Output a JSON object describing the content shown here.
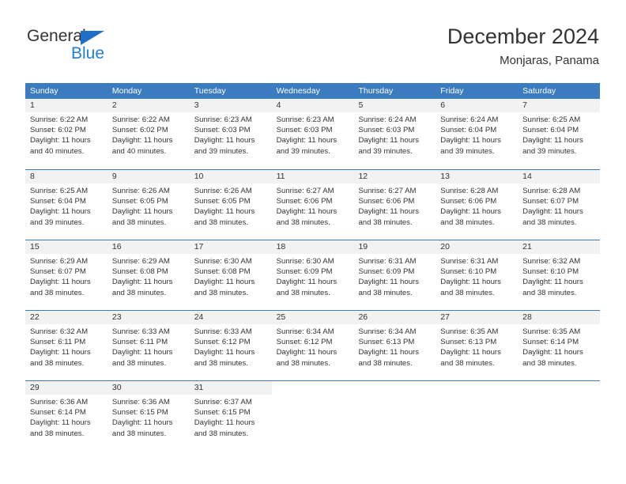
{
  "logo": {
    "word_one": "General",
    "word_two": "Blue",
    "triangle_icon": "blue-triangle-icon",
    "accent_color": "#1f7fd4"
  },
  "header": {
    "title": "December 2024",
    "subtitle": "Monjaras, Panama"
  },
  "theme": {
    "header_row_bg": "#3b7cc0",
    "day_number_band_bg": "#f2f2f2",
    "grid_line": "#3b7cc0",
    "text": "#333333"
  },
  "calendar": {
    "day_names": [
      "Sunday",
      "Monday",
      "Tuesday",
      "Wednesday",
      "Thursday",
      "Friday",
      "Saturday"
    ],
    "weeks": [
      [
        {
          "day": "1",
          "sunrise": "Sunrise: 6:22 AM",
          "sunset": "Sunset: 6:02 PM",
          "daylight_1": "Daylight: 11 hours",
          "daylight_2": "and 40 minutes."
        },
        {
          "day": "2",
          "sunrise": "Sunrise: 6:22 AM",
          "sunset": "Sunset: 6:02 PM",
          "daylight_1": "Daylight: 11 hours",
          "daylight_2": "and 40 minutes."
        },
        {
          "day": "3",
          "sunrise": "Sunrise: 6:23 AM",
          "sunset": "Sunset: 6:03 PM",
          "daylight_1": "Daylight: 11 hours",
          "daylight_2": "and 39 minutes."
        },
        {
          "day": "4",
          "sunrise": "Sunrise: 6:23 AM",
          "sunset": "Sunset: 6:03 PM",
          "daylight_1": "Daylight: 11 hours",
          "daylight_2": "and 39 minutes."
        },
        {
          "day": "5",
          "sunrise": "Sunrise: 6:24 AM",
          "sunset": "Sunset: 6:03 PM",
          "daylight_1": "Daylight: 11 hours",
          "daylight_2": "and 39 minutes."
        },
        {
          "day": "6",
          "sunrise": "Sunrise: 6:24 AM",
          "sunset": "Sunset: 6:04 PM",
          "daylight_1": "Daylight: 11 hours",
          "daylight_2": "and 39 minutes."
        },
        {
          "day": "7",
          "sunrise": "Sunrise: 6:25 AM",
          "sunset": "Sunset: 6:04 PM",
          "daylight_1": "Daylight: 11 hours",
          "daylight_2": "and 39 minutes."
        }
      ],
      [
        {
          "day": "8",
          "sunrise": "Sunrise: 6:25 AM",
          "sunset": "Sunset: 6:04 PM",
          "daylight_1": "Daylight: 11 hours",
          "daylight_2": "and 39 minutes."
        },
        {
          "day": "9",
          "sunrise": "Sunrise: 6:26 AM",
          "sunset": "Sunset: 6:05 PM",
          "daylight_1": "Daylight: 11 hours",
          "daylight_2": "and 38 minutes."
        },
        {
          "day": "10",
          "sunrise": "Sunrise: 6:26 AM",
          "sunset": "Sunset: 6:05 PM",
          "daylight_1": "Daylight: 11 hours",
          "daylight_2": "and 38 minutes."
        },
        {
          "day": "11",
          "sunrise": "Sunrise: 6:27 AM",
          "sunset": "Sunset: 6:06 PM",
          "daylight_1": "Daylight: 11 hours",
          "daylight_2": "and 38 minutes."
        },
        {
          "day": "12",
          "sunrise": "Sunrise: 6:27 AM",
          "sunset": "Sunset: 6:06 PM",
          "daylight_1": "Daylight: 11 hours",
          "daylight_2": "and 38 minutes."
        },
        {
          "day": "13",
          "sunrise": "Sunrise: 6:28 AM",
          "sunset": "Sunset: 6:06 PM",
          "daylight_1": "Daylight: 11 hours",
          "daylight_2": "and 38 minutes."
        },
        {
          "day": "14",
          "sunrise": "Sunrise: 6:28 AM",
          "sunset": "Sunset: 6:07 PM",
          "daylight_1": "Daylight: 11 hours",
          "daylight_2": "and 38 minutes."
        }
      ],
      [
        {
          "day": "15",
          "sunrise": "Sunrise: 6:29 AM",
          "sunset": "Sunset: 6:07 PM",
          "daylight_1": "Daylight: 11 hours",
          "daylight_2": "and 38 minutes."
        },
        {
          "day": "16",
          "sunrise": "Sunrise: 6:29 AM",
          "sunset": "Sunset: 6:08 PM",
          "daylight_1": "Daylight: 11 hours",
          "daylight_2": "and 38 minutes."
        },
        {
          "day": "17",
          "sunrise": "Sunrise: 6:30 AM",
          "sunset": "Sunset: 6:08 PM",
          "daylight_1": "Daylight: 11 hours",
          "daylight_2": "and 38 minutes."
        },
        {
          "day": "18",
          "sunrise": "Sunrise: 6:30 AM",
          "sunset": "Sunset: 6:09 PM",
          "daylight_1": "Daylight: 11 hours",
          "daylight_2": "and 38 minutes."
        },
        {
          "day": "19",
          "sunrise": "Sunrise: 6:31 AM",
          "sunset": "Sunset: 6:09 PM",
          "daylight_1": "Daylight: 11 hours",
          "daylight_2": "and 38 minutes."
        },
        {
          "day": "20",
          "sunrise": "Sunrise: 6:31 AM",
          "sunset": "Sunset: 6:10 PM",
          "daylight_1": "Daylight: 11 hours",
          "daylight_2": "and 38 minutes."
        },
        {
          "day": "21",
          "sunrise": "Sunrise: 6:32 AM",
          "sunset": "Sunset: 6:10 PM",
          "daylight_1": "Daylight: 11 hours",
          "daylight_2": "and 38 minutes."
        }
      ],
      [
        {
          "day": "22",
          "sunrise": "Sunrise: 6:32 AM",
          "sunset": "Sunset: 6:11 PM",
          "daylight_1": "Daylight: 11 hours",
          "daylight_2": "and 38 minutes."
        },
        {
          "day": "23",
          "sunrise": "Sunrise: 6:33 AM",
          "sunset": "Sunset: 6:11 PM",
          "daylight_1": "Daylight: 11 hours",
          "daylight_2": "and 38 minutes."
        },
        {
          "day": "24",
          "sunrise": "Sunrise: 6:33 AM",
          "sunset": "Sunset: 6:12 PM",
          "daylight_1": "Daylight: 11 hours",
          "daylight_2": "and 38 minutes."
        },
        {
          "day": "25",
          "sunrise": "Sunrise: 6:34 AM",
          "sunset": "Sunset: 6:12 PM",
          "daylight_1": "Daylight: 11 hours",
          "daylight_2": "and 38 minutes."
        },
        {
          "day": "26",
          "sunrise": "Sunrise: 6:34 AM",
          "sunset": "Sunset: 6:13 PM",
          "daylight_1": "Daylight: 11 hours",
          "daylight_2": "and 38 minutes."
        },
        {
          "day": "27",
          "sunrise": "Sunrise: 6:35 AM",
          "sunset": "Sunset: 6:13 PM",
          "daylight_1": "Daylight: 11 hours",
          "daylight_2": "and 38 minutes."
        },
        {
          "day": "28",
          "sunrise": "Sunrise: 6:35 AM",
          "sunset": "Sunset: 6:14 PM",
          "daylight_1": "Daylight: 11 hours",
          "daylight_2": "and 38 minutes."
        }
      ],
      [
        {
          "day": "29",
          "sunrise": "Sunrise: 6:36 AM",
          "sunset": "Sunset: 6:14 PM",
          "daylight_1": "Daylight: 11 hours",
          "daylight_2": "and 38 minutes."
        },
        {
          "day": "30",
          "sunrise": "Sunrise: 6:36 AM",
          "sunset": "Sunset: 6:15 PM",
          "daylight_1": "Daylight: 11 hours",
          "daylight_2": "and 38 minutes."
        },
        {
          "day": "31",
          "sunrise": "Sunrise: 6:37 AM",
          "sunset": "Sunset: 6:15 PM",
          "daylight_1": "Daylight: 11 hours",
          "daylight_2": "and 38 minutes."
        },
        {
          "day": "",
          "sunrise": "",
          "sunset": "",
          "daylight_1": "",
          "daylight_2": ""
        },
        {
          "day": "",
          "sunrise": "",
          "sunset": "",
          "daylight_1": "",
          "daylight_2": ""
        },
        {
          "day": "",
          "sunrise": "",
          "sunset": "",
          "daylight_1": "",
          "daylight_2": ""
        },
        {
          "day": "",
          "sunrise": "",
          "sunset": "",
          "daylight_1": "",
          "daylight_2": ""
        }
      ]
    ]
  }
}
